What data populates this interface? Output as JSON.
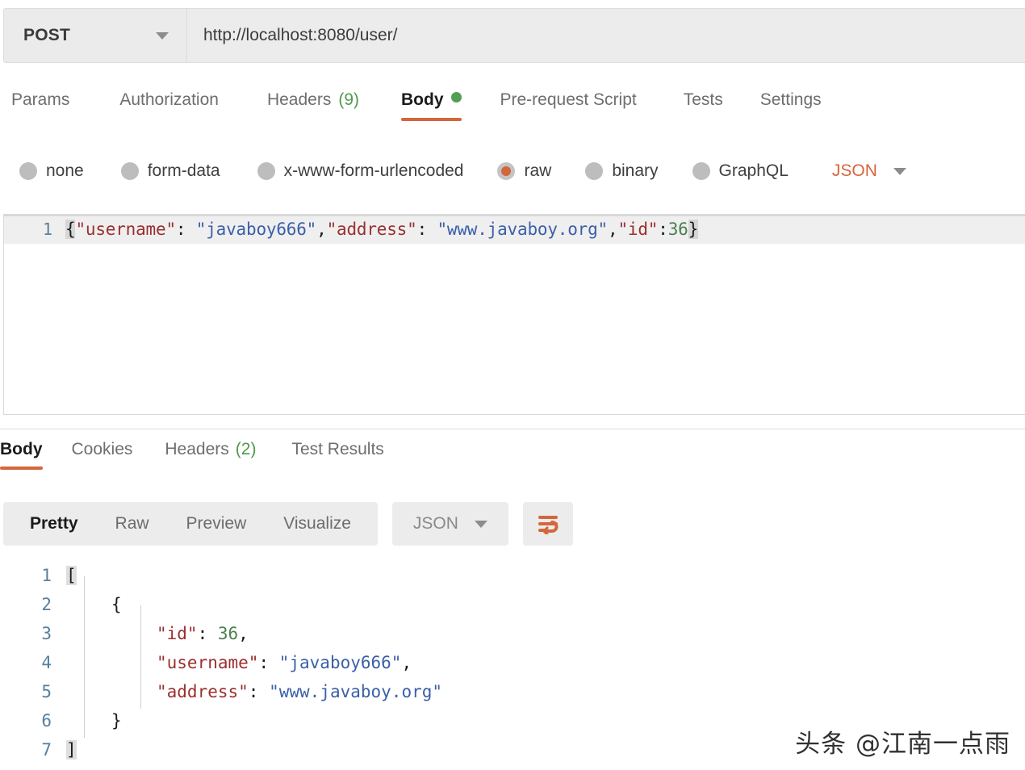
{
  "request": {
    "method": "POST",
    "url": "http://localhost:8080/user/",
    "tabs": [
      {
        "label": "Params",
        "active": false,
        "count": ""
      },
      {
        "label": "Authorization",
        "active": false,
        "count": ""
      },
      {
        "label": "Headers",
        "active": false,
        "count": "(9)"
      },
      {
        "label": "Body",
        "active": true,
        "count": ""
      },
      {
        "label": "Pre-request Script",
        "active": false,
        "count": ""
      },
      {
        "label": "Tests",
        "active": false,
        "count": ""
      },
      {
        "label": "Settings",
        "active": false,
        "count": ""
      }
    ],
    "body_types": [
      {
        "label": "none",
        "selected": false
      },
      {
        "label": "form-data",
        "selected": false
      },
      {
        "label": "x-www-form-urlencoded",
        "selected": false
      },
      {
        "label": "raw",
        "selected": true
      },
      {
        "label": "binary",
        "selected": false
      },
      {
        "label": "GraphQL",
        "selected": false
      }
    ],
    "content_type": "JSON",
    "editor": {
      "line_number": "1",
      "raw": "{\"username\": \"javaboy666\",\"address\": \"www.javaboy.org\",\"id\":36}",
      "tokens": [
        {
          "t": "{",
          "k": "brace"
        },
        {
          "t": "\"username\"",
          "k": "key"
        },
        {
          "t": ": ",
          "k": "punct"
        },
        {
          "t": "\"javaboy666\"",
          "k": "str"
        },
        {
          "t": ",",
          "k": "punct"
        },
        {
          "t": "\"address\"",
          "k": "key"
        },
        {
          "t": ": ",
          "k": "punct"
        },
        {
          "t": "\"www.javaboy.org\"",
          "k": "str"
        },
        {
          "t": ",",
          "k": "punct"
        },
        {
          "t": "\"id\"",
          "k": "key"
        },
        {
          "t": ":",
          "k": "punct"
        },
        {
          "t": "36",
          "k": "num"
        },
        {
          "t": "}",
          "k": "brace"
        }
      ]
    }
  },
  "response": {
    "tabs": [
      {
        "label": "Body",
        "active": true,
        "count": ""
      },
      {
        "label": "Cookies",
        "active": false,
        "count": ""
      },
      {
        "label": "Headers",
        "active": false,
        "count": "(2)"
      },
      {
        "label": "Test Results",
        "active": false,
        "count": ""
      }
    ],
    "view_modes": [
      {
        "label": "Pretty",
        "active": true
      },
      {
        "label": "Raw",
        "active": false
      },
      {
        "label": "Preview",
        "active": false
      },
      {
        "label": "Visualize",
        "active": false
      }
    ],
    "format": "JSON",
    "wrap_icon": "word-wrap-icon",
    "body_lines": [
      {
        "n": "1",
        "indent": 0,
        "tokens": [
          {
            "t": "[",
            "k": "hl"
          }
        ]
      },
      {
        "n": "2",
        "indent": 4,
        "tokens": [
          {
            "t": "{",
            "k": "punct"
          }
        ]
      },
      {
        "n": "3",
        "indent": 8,
        "tokens": [
          {
            "t": "\"id\"",
            "k": "key"
          },
          {
            "t": ": ",
            "k": "punct"
          },
          {
            "t": "36",
            "k": "num"
          },
          {
            "t": ",",
            "k": "punct"
          }
        ]
      },
      {
        "n": "4",
        "indent": 8,
        "tokens": [
          {
            "t": "\"username\"",
            "k": "key"
          },
          {
            "t": ": ",
            "k": "punct"
          },
          {
            "t": "\"javaboy666\"",
            "k": "str"
          },
          {
            "t": ",",
            "k": "punct"
          }
        ]
      },
      {
        "n": "5",
        "indent": 8,
        "tokens": [
          {
            "t": "\"address\"",
            "k": "key"
          },
          {
            "t": ": ",
            "k": "punct"
          },
          {
            "t": "\"www.javaboy.org\"",
            "k": "str"
          }
        ]
      },
      {
        "n": "6",
        "indent": 4,
        "tokens": [
          {
            "t": "}",
            "k": "punct"
          }
        ]
      },
      {
        "n": "7",
        "indent": 0,
        "tokens": [
          {
            "t": "]",
            "k": "hl"
          }
        ]
      }
    ]
  },
  "watermark": "头条 @江南一点雨",
  "colors": {
    "accent": "#d4663c",
    "green": "#539e53",
    "key": "#9c2f2f",
    "string": "#3b5fa8",
    "number": "#4b8050",
    "gutter": "#5580a0"
  }
}
